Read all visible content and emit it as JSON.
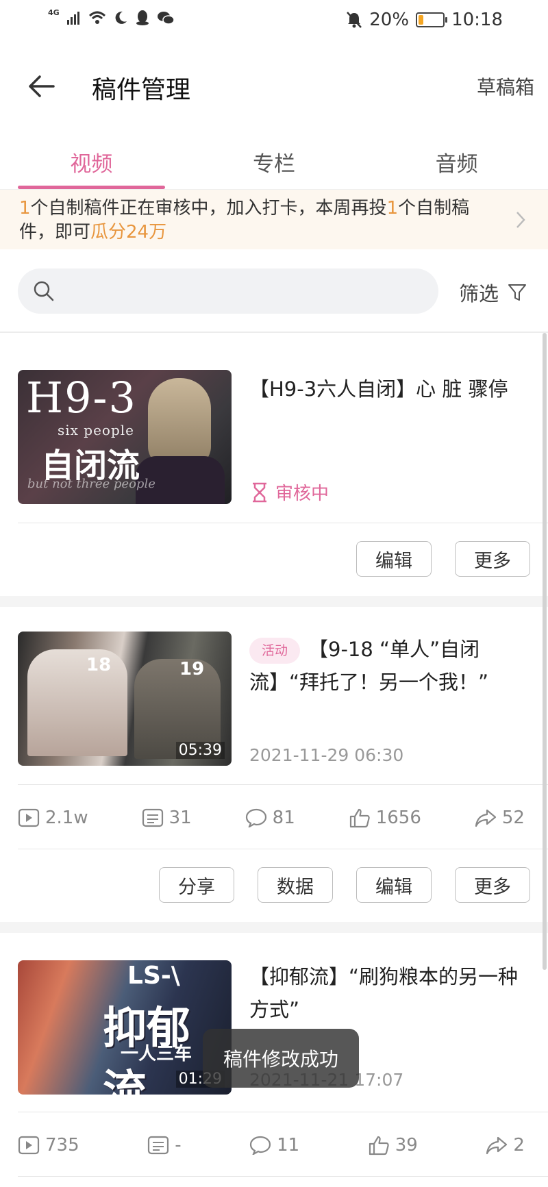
{
  "status_bar": {
    "network": "4G",
    "battery_text": "20%",
    "battery_level": 0.2,
    "time": "10:18"
  },
  "header": {
    "back_icon": "arrow-left-icon",
    "title": "稿件管理",
    "drafts_label": "草稿箱"
  },
  "tabs": [
    {
      "label": "视频",
      "active": true
    },
    {
      "label": "专栏",
      "active": false
    },
    {
      "label": "音频",
      "active": false
    }
  ],
  "banner": {
    "count1": "1",
    "text1": "个自制稿件正在审核中，加入打卡，本周再投",
    "count2": "1",
    "text2": "个自制稿件，即可",
    "reward": "瓜分24万"
  },
  "search": {
    "placeholder": "",
    "filter_label": "筛选"
  },
  "colors": {
    "accent": "#e0679a",
    "highlight": "#e8963e"
  },
  "videos": [
    {
      "title": "【H9-3六人自闭】心 脏 骤停",
      "thumb_line1": "H9-3",
      "thumb_line2": "six people",
      "thumb_line3": "自闭流",
      "thumb_line4": "but not three people",
      "status": "审核中",
      "actions": [
        "编辑",
        "更多"
      ]
    },
    {
      "tag": "活动",
      "title": "【9-18 “单人”自闭流】“拜托了！另一个我！”",
      "thumb_lvl1": "18",
      "thumb_lvl2": "19",
      "duration": "05:39",
      "date": "2021-11-29 06:30",
      "stats": {
        "plays": "2.1w",
        "danmaku": "31",
        "comments": "81",
        "likes": "1656",
        "shares": "52"
      },
      "actions": [
        "分享",
        "数据",
        "编辑",
        "更多"
      ]
    },
    {
      "title": "【抑郁流】“刷狗粮本的另一种方式”",
      "thumb_ls": "LS-\\",
      "thumb_big": "抑郁流",
      "thumb_sub": "一人三车",
      "duration": "01:29",
      "date": "2021-11-21 17:07",
      "stats": {
        "plays": "735",
        "danmaku": "-",
        "comments": "11",
        "likes": "39",
        "shares": "2"
      }
    }
  ],
  "toast": "稿件修改成功"
}
